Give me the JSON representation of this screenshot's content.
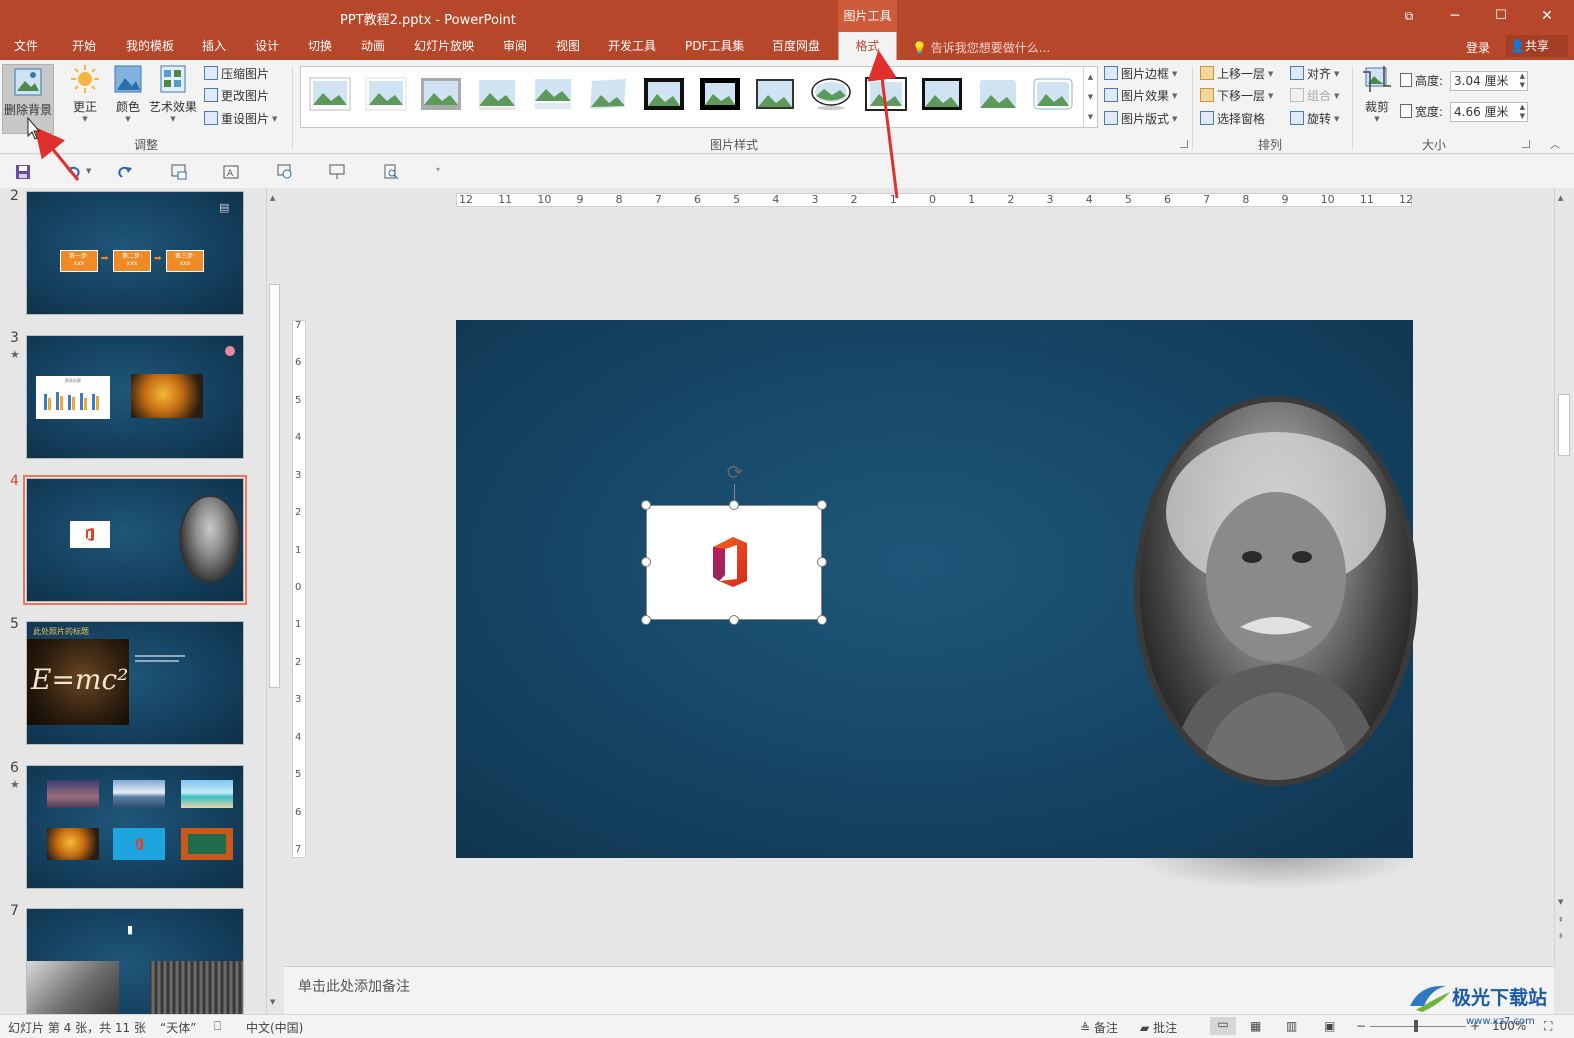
{
  "window": {
    "title": "PPT教程2.pptx - PowerPoint",
    "contextual_tab": "图片工具",
    "controls": {
      "restore": "⧉",
      "minimize": "─",
      "maximize": "☐",
      "close": "✕"
    }
  },
  "menu": {
    "tabs": [
      "文件",
      "开始",
      "我的模板",
      "插入",
      "设计",
      "切换",
      "动画",
      "幻灯片放映",
      "审阅",
      "视图",
      "开发工具",
      "PDF工具集",
      "百度网盘",
      "格式"
    ],
    "active_tab": "格式",
    "tell_me": "告诉我您想要做什么...",
    "login": "登录",
    "share": "共享"
  },
  "ribbon": {
    "adjust": {
      "remove_bg": "删除背景",
      "corrections": "更正",
      "color": "颜色",
      "artistic": "艺术效果",
      "compress": "压缩图片",
      "change": "更改图片",
      "reset": "重设图片",
      "group_label": "调整"
    },
    "styles": {
      "group_label": "图片样式",
      "border": "图片边框",
      "effects": "图片效果",
      "layout": "图片版式"
    },
    "arrange": {
      "group_label": "排列",
      "bring_forward": "上移一层",
      "send_backward": "下移一层",
      "selection_pane": "选择窗格",
      "align": "对齐",
      "group": "组合",
      "rotate": "旋转"
    },
    "size": {
      "group_label": "大小",
      "crop": "裁剪",
      "height_label": "高度:",
      "height_value": "3.04 厘米",
      "width_label": "宽度:",
      "width_value": "4.66 厘米"
    }
  },
  "thumbnails": {
    "slides": [
      {
        "number": "2",
        "star": "",
        "boxes": [
          "第一步:",
          "第二步:",
          "第三步:"
        ],
        "box_sub": "xxx"
      },
      {
        "number": "3",
        "star": "★",
        "chart_title": "图表标题"
      },
      {
        "number": "4",
        "star": ""
      },
      {
        "number": "5",
        "star": "",
        "heading": "此处照片的标题",
        "formula": "E=mc²"
      },
      {
        "number": "6",
        "star": "★"
      },
      {
        "number": "7",
        "star": ""
      }
    ],
    "active": "4"
  },
  "notes": {
    "placeholder": "单击此处添加备注"
  },
  "status": {
    "slide_info": "幻灯片 第 4 张，共 11 张",
    "theme": "“天体”",
    "language": "中文(中国)",
    "notes": "备注",
    "comments": "批注",
    "zoom": "100%"
  },
  "ruler": {
    "h_ticks": [
      "12",
      "11",
      "10",
      "9",
      "8",
      "7",
      "6",
      "5",
      "4",
      "3",
      "2",
      "1",
      "0",
      "1",
      "2",
      "3",
      "4",
      "5",
      "6",
      "7",
      "8",
      "9",
      "10",
      "11",
      "12"
    ],
    "v_ticks": [
      "7",
      "6",
      "5",
      "4",
      "3",
      "2",
      "1",
      "0",
      "1",
      "2",
      "3",
      "4",
      "5",
      "6",
      "7"
    ]
  },
  "watermark": {
    "text": "极光下载站",
    "url": "www.xz7.com"
  },
  "colors": {
    "accent": "#b7472a",
    "slide_bg": "#174868",
    "annotation": "#e0302c"
  }
}
